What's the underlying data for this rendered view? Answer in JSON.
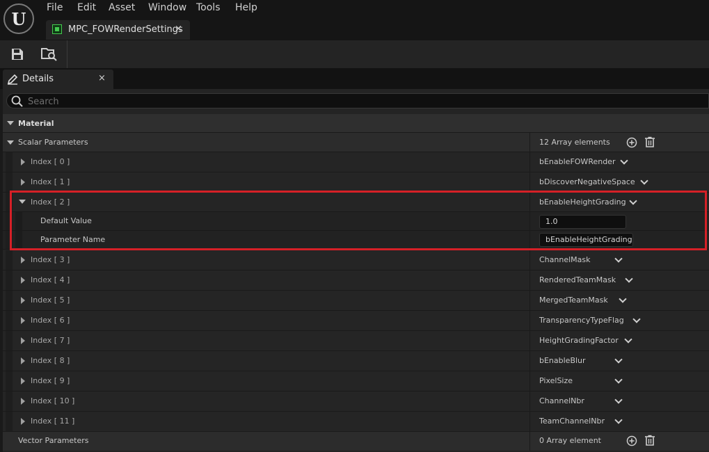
{
  "menu": [
    "File",
    "Edit",
    "Asset",
    "Window",
    "Tools",
    "Help"
  ],
  "document_tab": {
    "label": "MPC_FOWRenderSettings",
    "close": "×"
  },
  "panel_tab": {
    "label": "Details",
    "close": "×"
  },
  "search": {
    "placeholder": "Search"
  },
  "material": {
    "label": "Material"
  },
  "scalar": {
    "label": "Scalar Parameters",
    "count": "12 Array elements",
    "entries": [
      {
        "index": "Index [ 0 ]",
        "name": "bEnableFOWRender"
      },
      {
        "index": "Index [ 1 ]",
        "name": "bDiscoverNegativeSpace"
      },
      {
        "index": "Index [ 2 ]",
        "name": "bEnableHeightGrading"
      },
      {
        "index": "Index [ 3 ]",
        "name": "ChannelMask"
      },
      {
        "index": "Index [ 4 ]",
        "name": "RenderedTeamMask"
      },
      {
        "index": "Index [ 5 ]",
        "name": "MergedTeamMask"
      },
      {
        "index": "Index [ 6 ]",
        "name": "TransparencyTypeFlag"
      },
      {
        "index": "Index [ 7 ]",
        "name": "HeightGradingFactor"
      },
      {
        "index": "Index [ 8 ]",
        "name": "bEnableBlur"
      },
      {
        "index": "Index [ 9 ]",
        "name": "PixelSize"
      },
      {
        "index": "Index [ 10 ]",
        "name": "ChannelNbr"
      },
      {
        "index": "Index [ 11 ]",
        "name": "TeamChannelNbr"
      }
    ],
    "expanded": {
      "default_value_label": "Default Value",
      "default_value": "1.0",
      "parameter_name_label": "Parameter Name",
      "parameter_name": "bEnableHeightGrading"
    }
  },
  "vector": {
    "label": "Vector Parameters",
    "count": "0 Array element"
  },
  "colors": {
    "highlight": "#d62027",
    "asset_icon": "#45c94f"
  }
}
